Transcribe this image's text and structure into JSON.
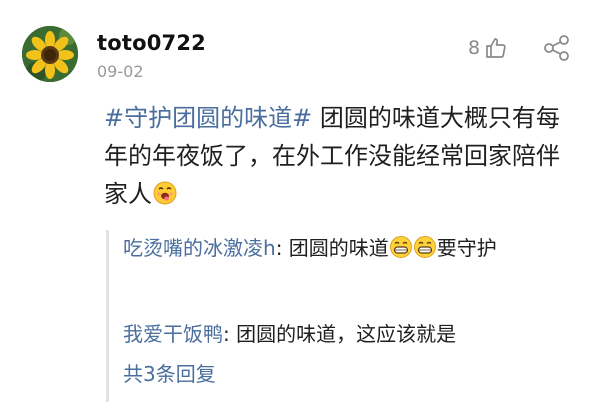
{
  "comment": {
    "username": "toto0722",
    "date": "09-02",
    "like_count": "8",
    "icons": {
      "avatar": "sunflower-avatar",
      "like": "thumbs-up-icon",
      "share": "share-icon",
      "emoji_main": "drooling-face-emoji",
      "emoji_grin": "grinning-face-emoji"
    },
    "hashtag": "#守护团圆的味道#",
    "body": " 团圆的味道大概只有每年的年夜饭了，在外工作没能经常回家陪伴家人"
  },
  "replies": {
    "items": [
      {
        "name": "吃烫嘴的冰激凌h",
        "separator": ":",
        "text_before_emoji": " 团圆的味道",
        "text_after_emoji": "要守护"
      },
      {
        "name": "我爱干饭鸭",
        "separator": ":",
        "text": " 团圆的味道，这应该就是"
      }
    ],
    "more_label": "共3条回复"
  },
  "colors": {
    "link_blue": "#4a6e9e",
    "meta_gray": "#9a9a9a",
    "text_dark": "#1f1f1f"
  }
}
